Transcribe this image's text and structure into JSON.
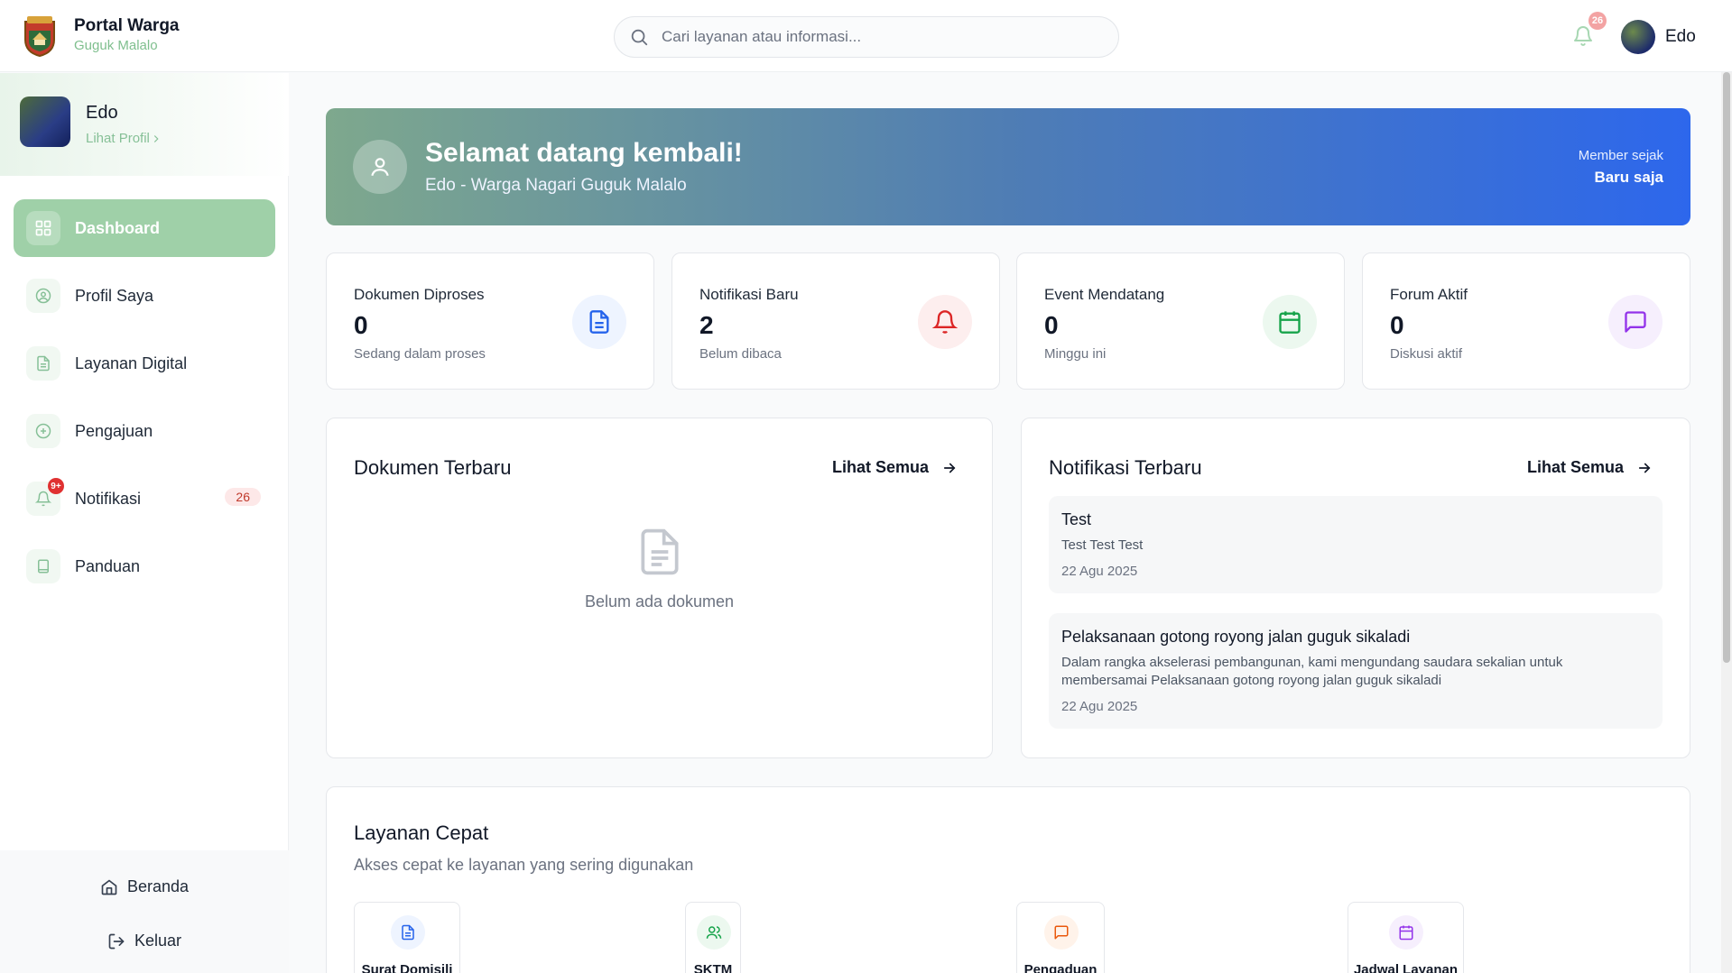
{
  "header": {
    "app_title": "Portal Warga",
    "app_subtitle": "Guguk Malalo",
    "search_placeholder": "Cari layanan atau informasi...",
    "notification_count": "26",
    "user_name": "Edo"
  },
  "sidebar": {
    "profile_name": "Edo",
    "profile_link": "Lihat Profil",
    "items": [
      {
        "label": "Dashboard",
        "icon": "grid-icon",
        "active": true
      },
      {
        "label": "Profil Saya",
        "icon": "user-circle-icon"
      },
      {
        "label": "Layanan Digital",
        "icon": "document-icon"
      },
      {
        "label": "Pengajuan",
        "icon": "plus-circle-icon"
      },
      {
        "label": "Notifikasi",
        "icon": "bell-icon",
        "mini_badge": "9+",
        "count": "26"
      },
      {
        "label": "Panduan",
        "icon": "book-icon"
      }
    ],
    "footer": {
      "home": "Beranda",
      "logout": "Keluar"
    }
  },
  "hero": {
    "title": "Selamat datang kembali!",
    "subtitle": "Edo - Warga Nagari Guguk Malalo",
    "member_label": "Member sejak",
    "member_value": "Baru saja"
  },
  "stats": [
    {
      "label": "Dokumen Diproses",
      "value": "0",
      "sub": "Sedang dalam proses",
      "icon": "document-icon",
      "color": "#2563eb",
      "bg": "#eef4ff"
    },
    {
      "label": "Notifikasi Baru",
      "value": "2",
      "sub": "Belum dibaca",
      "icon": "bell-icon",
      "color": "#dc2626",
      "bg": "#fdeeee"
    },
    {
      "label": "Event Mendatang",
      "value": "0",
      "sub": "Minggu ini",
      "icon": "calendar-icon",
      "color": "#16a34a",
      "bg": "#ecf8ef"
    },
    {
      "label": "Forum Aktif",
      "value": "0",
      "sub": "Diskusi aktif",
      "icon": "chat-icon",
      "color": "#9333ea",
      "bg": "#f6effd"
    }
  ],
  "documents": {
    "title": "Dokumen Terbaru",
    "link": "Lihat Semua",
    "empty": "Belum ada dokumen"
  },
  "notifications": {
    "title": "Notifikasi Terbaru",
    "link": "Lihat Semua",
    "items": [
      {
        "title": "Test",
        "body": "Test Test Test",
        "date": "22 Agu 2025"
      },
      {
        "title": "Pelaksanaan gotong royong jalan guguk sikaladi",
        "body": "Dalam rangka akselerasi pembangunan, kami mengundang saudara sekalian untuk membersamai Pelaksanaan gotong royong jalan guguk sikaladi",
        "date": "22 Agu 2025"
      }
    ]
  },
  "quick": {
    "title": "Layanan Cepat",
    "subtitle": "Akses cepat ke layanan yang sering digunakan",
    "items": [
      {
        "label": "Surat Domisili",
        "icon": "document-icon",
        "color": "#2563eb",
        "bg": "#eef4ff"
      },
      {
        "label": "SKTM",
        "icon": "users-icon",
        "color": "#16a34a",
        "bg": "#ecf8ef"
      },
      {
        "label": "Pengaduan",
        "icon": "chat-icon",
        "color": "#ea580c",
        "bg": "#fff3ea"
      },
      {
        "label": "Jadwal Layanan",
        "icon": "calendar-icon",
        "color": "#9333ea",
        "bg": "#f6effd"
      }
    ]
  }
}
